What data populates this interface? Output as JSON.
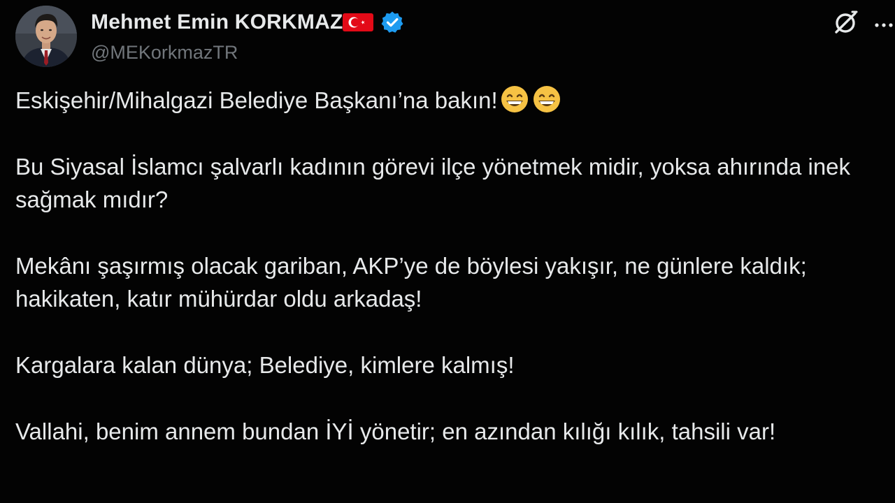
{
  "author": {
    "display_name": "Mehmet Emin KORKMAZ",
    "handle": "@MEKorkmazTR",
    "flag": "turkey-flag",
    "verified": true
  },
  "icons": {
    "avatar": "profile-photo",
    "grok": "grok-icon",
    "more": "more-icon",
    "emoji": "grinning-face-with-smiling-eyes-emoji"
  },
  "tweet": {
    "paragraphs": [
      "Eskişehir/Mihalgazi Belediye Başkanı’na bakın!",
      "Bu Siyasal İslamcı şalvarlı kadının görevi ilçe yönetmek midir, yoksa ahırında inek sağmak mıdır?",
      "Mekânı şaşırmış olacak gariban, AKP’ye de böylesi yakışır, ne günlere kaldık; hakikaten, katır mühürdar oldu arkadaş!",
      "Kargalara kalan dünya; Belediye, kimlere kalmış!",
      "Vallahi, benim annem bundan İYİ yönetir; en azından kılığı kılık, tahsili var!"
    ]
  },
  "colors": {
    "background": "#030303",
    "text": "#e7e9ea",
    "muted": "#71767b",
    "verified_blue": "#1d9bf0",
    "flag_red": "#e30a17",
    "emoji_yellow": "#f6c244"
  }
}
